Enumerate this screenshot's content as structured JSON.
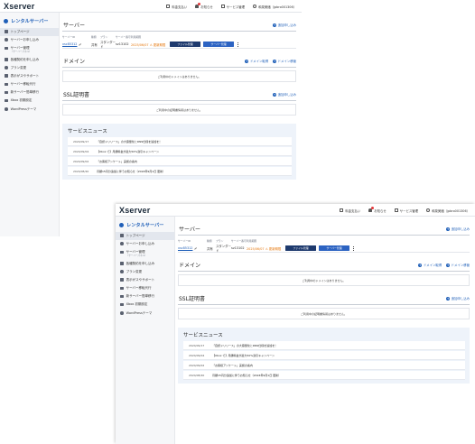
{
  "app": {
    "logo": "Xserver",
    "topnav": {
      "fees": "料金支払い",
      "notifications": "お知らせ",
      "service": "サービス管理",
      "account": "和泉美緒（jpbro001306）"
    }
  },
  "sidebar": {
    "heading": "レンタルサーバー",
    "items": [
      {
        "label": "トップページ",
        "sub": ""
      },
      {
        "label": "サーバーお申し込み",
        "sub": ""
      },
      {
        "label": "サーバー管理",
        "sub": "（サーバーパネル）"
      },
      {
        "label": "各種契約を申し込み",
        "sub": ""
      },
      {
        "label": "プラン変更",
        "sub": ""
      },
      {
        "label": "表示がスやサポート",
        "sub": ""
      },
      {
        "label": "サーバー移転代行",
        "sub": ""
      },
      {
        "label": "新サーバー簡単移行",
        "sub": ""
      },
      {
        "label": "Xbox 初期設定",
        "sub": ""
      },
      {
        "label": "WordPressテーマ",
        "sub": ""
      }
    ]
  },
  "server": {
    "title": "サーバー",
    "add": "追加申し込み",
    "columns": [
      "サーバーID",
      "種類",
      "プラン",
      "サーバー番号",
      "利用期限"
    ],
    "row": {
      "id": "xsc85312",
      "type": "共有",
      "plan": "スタンダード",
      "number": "sv13102",
      "expire": "2025/06/07  ⚠ 更新期限",
      "btn_file": "ファイル管理",
      "btn_panel": "サーバー管理"
    }
  },
  "domain": {
    "title": "ドメイン",
    "acquire": "ドメイン取得",
    "transfer": "ドメイン移管",
    "empty": "ご利用中のドメインはありません。"
  },
  "ssl": {
    "title": "SSL証明書",
    "add": "追加申し込み",
    "empty": "ご利用中の証明書情報はありません。"
  },
  "news": {
    "title": "サービスニュース",
    "items": [
      {
        "date": "2024/09/17",
        "text": "「自訳ドリリース」の大容量化とDNS仕様を追加を！"
      },
      {
        "date": "2024/09/04",
        "text": "【Xbox で】月額料金が最大50%割引キャンペーン"
      },
      {
        "date": "2024/09/02",
        "text": "「お客様アンケート」実施の案内"
      },
      {
        "date": "2024/08/20",
        "text": "月額15円分追加に伴うお知らせ（2024年9月1日 更新）"
      }
    ]
  },
  "colors": {
    "accent": "#1f5fb8",
    "navy_button": "#1e3a6e",
    "warning": "#e5780f",
    "news_bg": "#eef3fa"
  }
}
